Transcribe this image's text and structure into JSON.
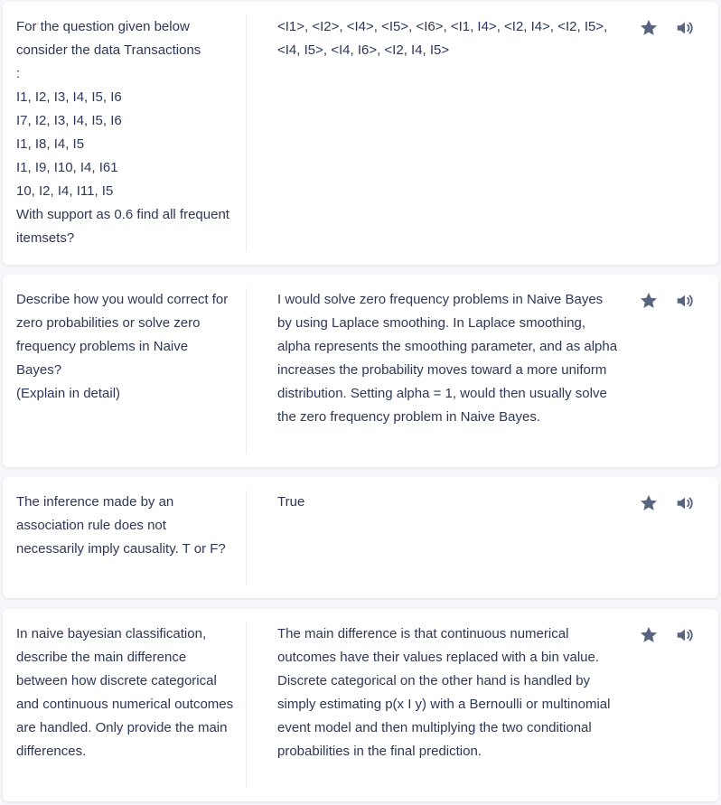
{
  "colors": {
    "page_bg": "#f6f7fb",
    "card_bg": "#ffffff",
    "text": "#2e3856",
    "icon": "#586380",
    "divider": "#e8ebf2"
  },
  "cards": [
    {
      "term": "For the question given below consider the data Transactions\n:\nI1, I2, I3, I4, I5, I6\nI7, I2, I3, I4, I5, I6\nI1, I8, I4, I5\nI1, I9, I10, I4, I61\n10, I2, I4, I11, I5\nWith support as 0.6 find all frequent itemsets?",
      "definition": "<I1>, <I2>, <I4>, <I5>, <I6>, <I1, I4>, <I2, I4>, <I2, I5>, <I4, I5>, <I4, I6>, <I2, I4, I5>",
      "star_icon": "star-icon",
      "audio_icon": "speaker-icon"
    },
    {
      "term": "Describe how you would correct for zero probabilities or solve zero frequency problems in Naive Bayes?\n(Explain in detail)",
      "definition": "I would solve zero frequency problems in Naive Bayes by using Laplace smoothing. In Laplace smoothing, alpha represents the smoothing parameter, and as alpha increases the probability moves toward a more uniform distribution. Setting alpha = 1, would then usually solve the zero frequency problem in Naive Bayes.",
      "star_icon": "star-icon",
      "audio_icon": "speaker-icon"
    },
    {
      "term": "The inference made by an association rule does not necessarily imply causality. T or F?",
      "definition": "True",
      "star_icon": "star-icon",
      "audio_icon": "speaker-icon"
    },
    {
      "term": "In naive bayesian classification, describe the main difference between how discrete categorical and continuous numerical outcomes are handled. Only provide the main differences.",
      "definition": "The main difference is that continuous numerical outcomes have their values replaced with a bin value. Discrete categorical on the other hand is handled by simply estimating p(x I y) with a Bernoulli or multinomial event model and then multiplying the two conditional probabilities in the final prediction.",
      "star_icon": "star-icon",
      "audio_icon": "speaker-icon"
    }
  ]
}
